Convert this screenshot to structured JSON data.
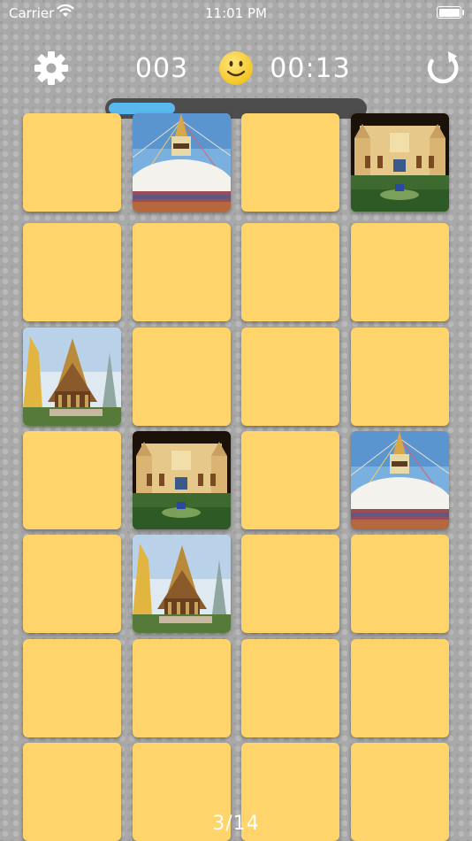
{
  "status_bar": {
    "carrier": "Carrier",
    "time": "11:01 PM"
  },
  "toolbar": {
    "score": "003",
    "timer": "00:13",
    "icons": [
      "gear-icon",
      "smiley-icon",
      "restart-icon"
    ],
    "progress": 0.26
  },
  "board": {
    "columns": 4,
    "rows": 7,
    "tiles": [
      "hidden",
      "stupa",
      "hidden",
      "palace",
      "hidden",
      "hidden",
      "hidden",
      "hidden",
      "temple",
      "hidden",
      "hidden",
      "hidden",
      "hidden",
      "palace",
      "hidden",
      "stupa",
      "hidden",
      "temple",
      "hidden",
      "hidden",
      "hidden",
      "hidden",
      "hidden",
      "hidden",
      "hidden",
      "hidden",
      "hidden",
      "hidden"
    ]
  },
  "footer": {
    "page_counter": "3/14"
  },
  "colors": {
    "tile_back": "#ffd56b",
    "progress_fill": "#5ab8f0",
    "progress_track": "#4d4d4d",
    "smiley": "#ffd43b"
  }
}
